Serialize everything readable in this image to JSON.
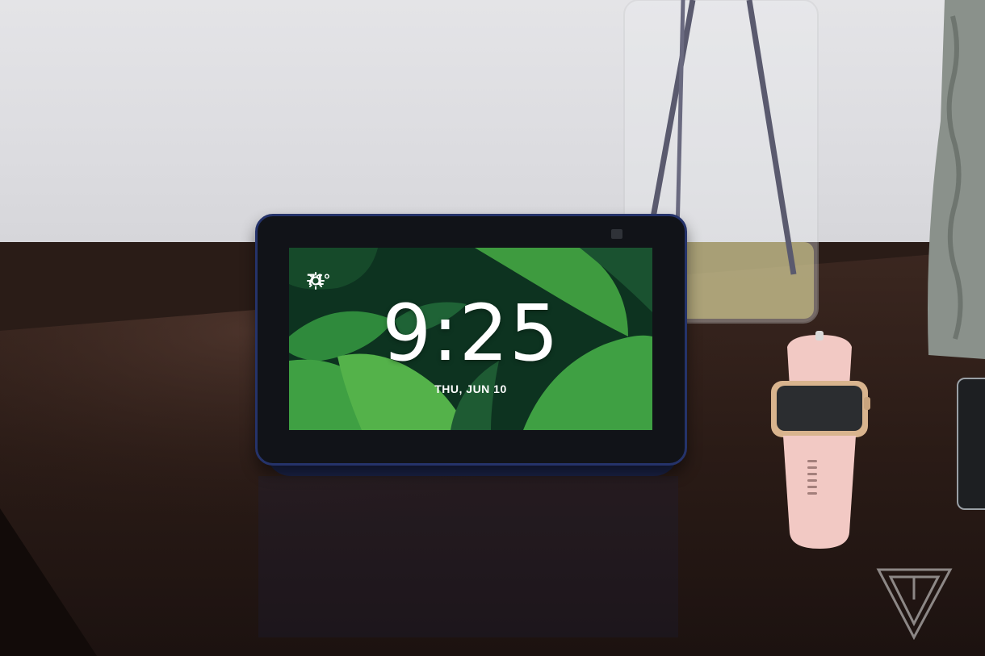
{
  "device_screen": {
    "weather_icon": "sun-icon",
    "temperature": "71°",
    "time": "9:25",
    "date": "THU, JUN 10"
  },
  "colors": {
    "device_frame": "#25336a",
    "screen_leaf": "#2f8a3c",
    "watch_band": "#f2c9c4",
    "table": "#2a1c17"
  }
}
